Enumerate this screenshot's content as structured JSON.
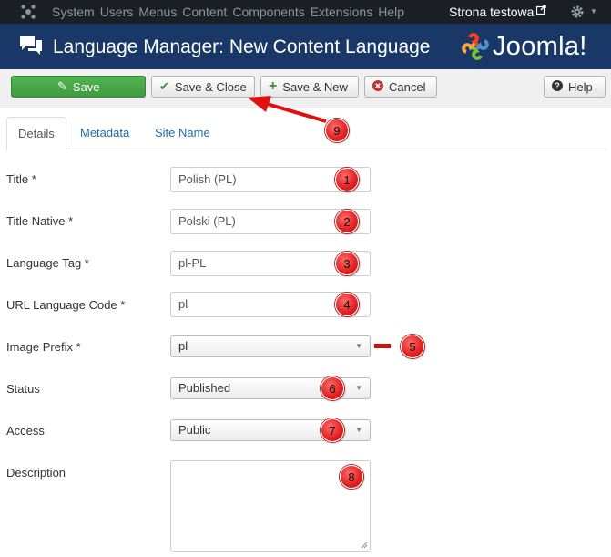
{
  "topbar": {
    "menu": [
      "System",
      "Users",
      "Menus",
      "Content",
      "Components",
      "Extensions",
      "Help"
    ],
    "site_name": "Strona testowa",
    "icons": [
      "joomla-logo-icon",
      "external-link-icon",
      "gear-icon",
      "caret-down-icon"
    ]
  },
  "header": {
    "title": "Language Manager: New Content Language",
    "brand": "Joomla!",
    "icon": "speech-bubbles-icon"
  },
  "toolbar": {
    "save": "Save",
    "save_close": "Save & Close",
    "save_new": "Save & New",
    "cancel": "Cancel",
    "help": "Help"
  },
  "tabs": [
    "Details",
    "Metadata",
    "Site Name"
  ],
  "form": {
    "title": {
      "label": "Title *",
      "value": "Polish (PL)"
    },
    "title_native": {
      "label": "Title Native *",
      "value": "Polski (PL)"
    },
    "language_tag": {
      "label": "Language Tag *",
      "value": "pl-PL"
    },
    "url_code": {
      "label": "URL Language Code *",
      "value": "pl"
    },
    "image_prefix": {
      "label": "Image Prefix *",
      "value": "pl"
    },
    "status": {
      "label": "Status",
      "value": "Published"
    },
    "access": {
      "label": "Access",
      "value": "Public"
    },
    "description": {
      "label": "Description",
      "value": ""
    }
  },
  "markers": [
    "1",
    "2",
    "3",
    "4",
    "5",
    "6",
    "7",
    "8",
    "9"
  ],
  "colors": {
    "topbar": "#1c1f24",
    "header": "#1a3867",
    "save_button": "#46a546",
    "link": "#1f6ea9",
    "marker": "#e02020"
  }
}
